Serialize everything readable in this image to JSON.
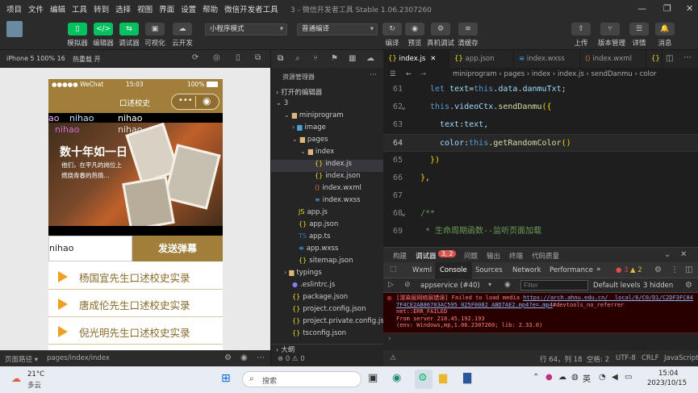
{
  "menu": [
    "项目",
    "文件",
    "编辑",
    "工具",
    "转到",
    "选择",
    "视图",
    "界面",
    "设置",
    "帮助",
    "微信开发者工具"
  ],
  "window_title": "3 - 微信开发者工具 Stable 1.06.2307260",
  "toolbar": {
    "left": [
      "模拟器",
      "编辑器",
      "调试器",
      "可视化",
      "云开发"
    ],
    "mode_select": "小程序模式",
    "compile_select": "普通编译",
    "mid": [
      "编译",
      "预览",
      "真机调试",
      "清缓存"
    ],
    "right": [
      "上传",
      "版本管理",
      "详情",
      "消息"
    ]
  },
  "simulator": {
    "device": "iPhone 5 100% 16",
    "hotreload": "热重载 开",
    "status_carrier": "●●●●● WeChat",
    "status_time": "15:03",
    "status_battery": "100%",
    "nav_title": "口述校史",
    "danmu": [
      "ao",
      "nihao",
      "nihao",
      "nihao",
      "nihao"
    ],
    "banner_title": "数十年如一日",
    "banner_sub1": "他们，在平凡的岗位上",
    "banner_sub2": "燃烧青春的热情...",
    "input_value": "nihao",
    "send_button": "发送弹幕",
    "list": [
      "杨国宜先生口述校史实录",
      "唐成伦先生口述校史实录",
      "倪光明先生口述校史实录"
    ],
    "footer_path": "页面路径 ▾",
    "footer_page": "pages/index/index"
  },
  "explorer": {
    "header": "资源管理器",
    "open_editors": "打开的编辑器",
    "root": "3",
    "items": [
      {
        "label": "miniprogram",
        "type": "folder"
      },
      {
        "label": "image",
        "type": "folder"
      },
      {
        "label": "pages",
        "type": "folder"
      },
      {
        "label": "index",
        "type": "folder"
      },
      {
        "label": "index.js",
        "type": "js"
      },
      {
        "label": "index.json",
        "type": "json"
      },
      {
        "label": "index.wxml",
        "type": "wxml"
      },
      {
        "label": "index.wxss",
        "type": "wxss"
      },
      {
        "label": "app.js",
        "type": "js"
      },
      {
        "label": "app.json",
        "type": "json"
      },
      {
        "label": "app.ts",
        "type": "ts"
      },
      {
        "label": "app.wxss",
        "type": "wxss"
      },
      {
        "label": "sitemap.json",
        "type": "json"
      },
      {
        "label": "typings",
        "type": "folder"
      },
      {
        "label": ".eslintrc.js",
        "type": "js"
      },
      {
        "label": "package.json",
        "type": "json"
      },
      {
        "label": "project.config.json",
        "type": "json"
      },
      {
        "label": "project.private.config.js...",
        "type": "json"
      },
      {
        "label": "tsconfig.json",
        "type": "json"
      }
    ],
    "outline": "大纲",
    "footer": "⊗ 0 ⚠ 0"
  },
  "editor": {
    "tabs": [
      "index.js",
      "app.json",
      "index.wxss",
      "index.wxml",
      "{}"
    ],
    "breadcrumb": "miniprogram › pages › index › index.js › sendDanmu › color",
    "lines": [
      {
        "n": "61",
        "t": "let text=this.data.danmuTxt;"
      },
      {
        "n": "62",
        "t": "this.videoCtx.sendDanmu({"
      },
      {
        "n": "63",
        "t": "text:text,"
      },
      {
        "n": "64",
        "t": "color:this.getRandomColor()"
      },
      {
        "n": "65",
        "t": "})"
      },
      {
        "n": "66",
        "t": "},"
      },
      {
        "n": "67",
        "t": ""
      },
      {
        "n": "68",
        "t": "/**"
      },
      {
        "n": "69",
        "t": " * 生命周期函数--监听页面加载"
      }
    ]
  },
  "devtools": {
    "tabs": [
      "构建",
      "调试器",
      "问题",
      "输出",
      "终端",
      "代码质量"
    ],
    "badge": "3, 2",
    "subtabs": [
      "Wxml",
      "Console",
      "Sources",
      "Network",
      "Performance"
    ],
    "errors": "3",
    "warnings": "2",
    "context": "appservice (#40)",
    "filter_placeholder": "Filter",
    "levels": "Default levels",
    "hidden": "3 hidden",
    "error_line1": "[渲染层网络层错误] Failed to load media",
    "error_link": "https://arch.ahnu.edu.cn/__local/6/C0/D1/C2DF3FC847F4CE2AB86703AC595_025F0082_ABD7AE2.mp4?e=.mp4",
    "error_suffix": "#devtools_no_referrer",
    "error_line3": "net::ERR_FAILED",
    "error_line4": "From server 210.45.192.193",
    "error_line5": "(env: Windows,mp,1.06.2307260; lib: 2.33.0)"
  },
  "statusbar": {
    "pos": "行 64，列 18",
    "spaces": "空格: 2",
    "enc": "UTF-8",
    "eol": "CRLF",
    "lang": "JavaScript"
  },
  "taskbar": {
    "temp": "21°C",
    "weather": "多云",
    "search": "搜索",
    "lang": "英",
    "time": "15:04",
    "date": "2023/10/15"
  }
}
